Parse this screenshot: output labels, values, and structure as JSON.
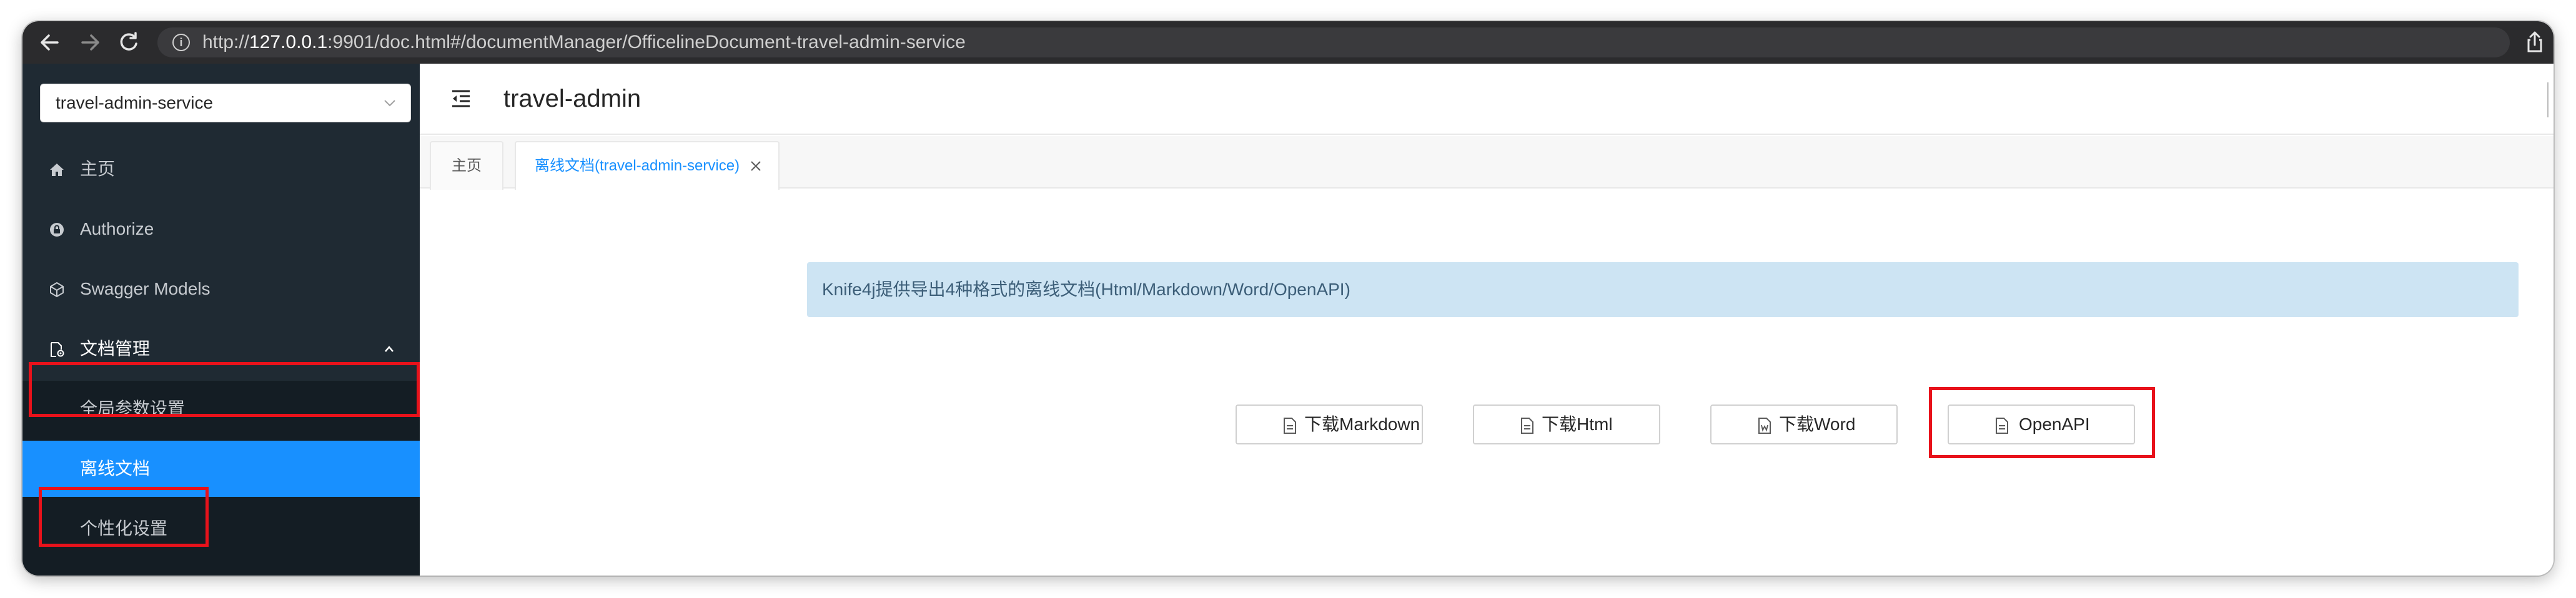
{
  "browser": {
    "url_prefix": "http://",
    "url_host": "127.0.0.1",
    "url_rest": ":9901/doc.html#/documentManager/OfficelineDocument-travel-admin-service"
  },
  "sidebar": {
    "service_select": "travel-admin-service",
    "items": [
      {
        "label": "主页",
        "icon": "home-icon"
      },
      {
        "label": "Authorize",
        "icon": "lock-icon"
      },
      {
        "label": "Swagger Models",
        "icon": "models-icon"
      },
      {
        "label": "文档管理",
        "icon": "document-manage-icon",
        "expanded": true
      }
    ],
    "subitems": [
      {
        "label": "全局参数设置",
        "active": false
      },
      {
        "label": "离线文档",
        "active": true
      },
      {
        "label": "个性化设置",
        "active": false
      }
    ]
  },
  "header": {
    "title": "travel-admin"
  },
  "tabs": [
    {
      "label": "主页",
      "active": false
    },
    {
      "label": "离线文档(travel-admin-service)",
      "active": true,
      "closable": true
    }
  ],
  "alert": {
    "text": "Knife4j提供导出4种格式的离线文档(Html/Markdown/Word/OpenAPI)"
  },
  "buttons": {
    "markdown": "下载Markdown",
    "html": "下载Html",
    "word": "下载Word",
    "openapi": "OpenAPI"
  },
  "colors": {
    "sidebar_bg": "#1f2a33",
    "active_blue": "#1890ff",
    "highlight_red": "#e8121b",
    "alert_bg": "#cde4f3"
  }
}
